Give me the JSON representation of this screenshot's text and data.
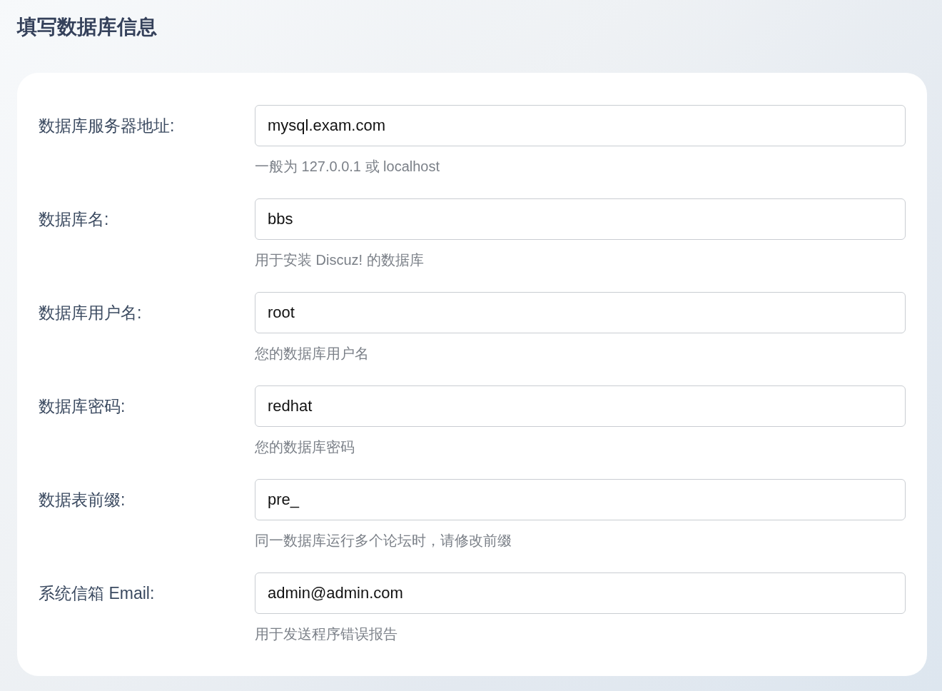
{
  "title": "填写数据库信息",
  "fields": [
    {
      "label": "数据库服务器地址:",
      "value": "mysql.exam.com",
      "hint": "一般为 127.0.0.1 或 localhost"
    },
    {
      "label": "数据库名:",
      "value": "bbs",
      "hint": "用于安装 Discuz! 的数据库"
    },
    {
      "label": "数据库用户名:",
      "value": "root",
      "hint": "您的数据库用户名"
    },
    {
      "label": "数据库密码:",
      "value": "redhat",
      "hint": "您的数据库密码"
    },
    {
      "label": "数据表前缀:",
      "value": "pre_",
      "hint": "同一数据库运行多个论坛时，请修改前缀"
    },
    {
      "label": "系统信箱 Email:",
      "value": "admin@admin.com",
      "hint": "用于发送程序错误报告"
    }
  ]
}
